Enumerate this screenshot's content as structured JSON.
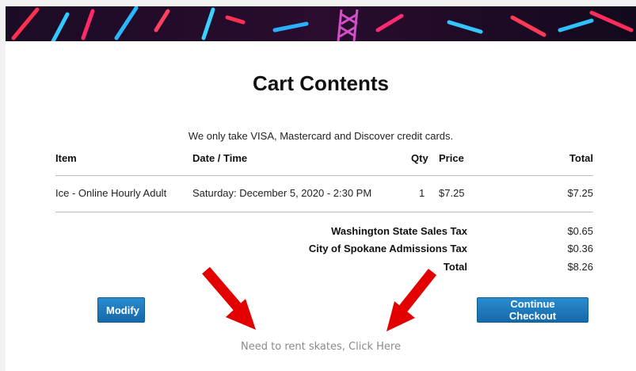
{
  "page": {
    "title": "Cart Contents",
    "notice": "We only take VISA, Mastercard and Discover credit cards."
  },
  "table": {
    "headers": {
      "item": "Item",
      "datetime": "Date / Time",
      "qty": "Qty",
      "price": "Price",
      "total": "Total"
    },
    "rows": [
      {
        "item": "Ice - Online Hourly Adult",
        "datetime": "Saturday: December 5, 2020 - 2:30 PM",
        "qty": "1",
        "price": "$7.25",
        "total": "$7.25"
      }
    ]
  },
  "summary": [
    {
      "label": "Washington State Sales Tax",
      "value": "$0.65"
    },
    {
      "label": "City of Spokane Admissions Tax",
      "value": "$0.36"
    },
    {
      "label": "Total",
      "value": "$8.26"
    }
  ],
  "buttons": {
    "modify": "Modify",
    "continue": "Continue Checkout"
  },
  "rent_link": "Need to rent skates, Click Here",
  "colors": {
    "button": "#1a75b8",
    "arrow": "#e30000",
    "link": "#8a8a8a"
  }
}
